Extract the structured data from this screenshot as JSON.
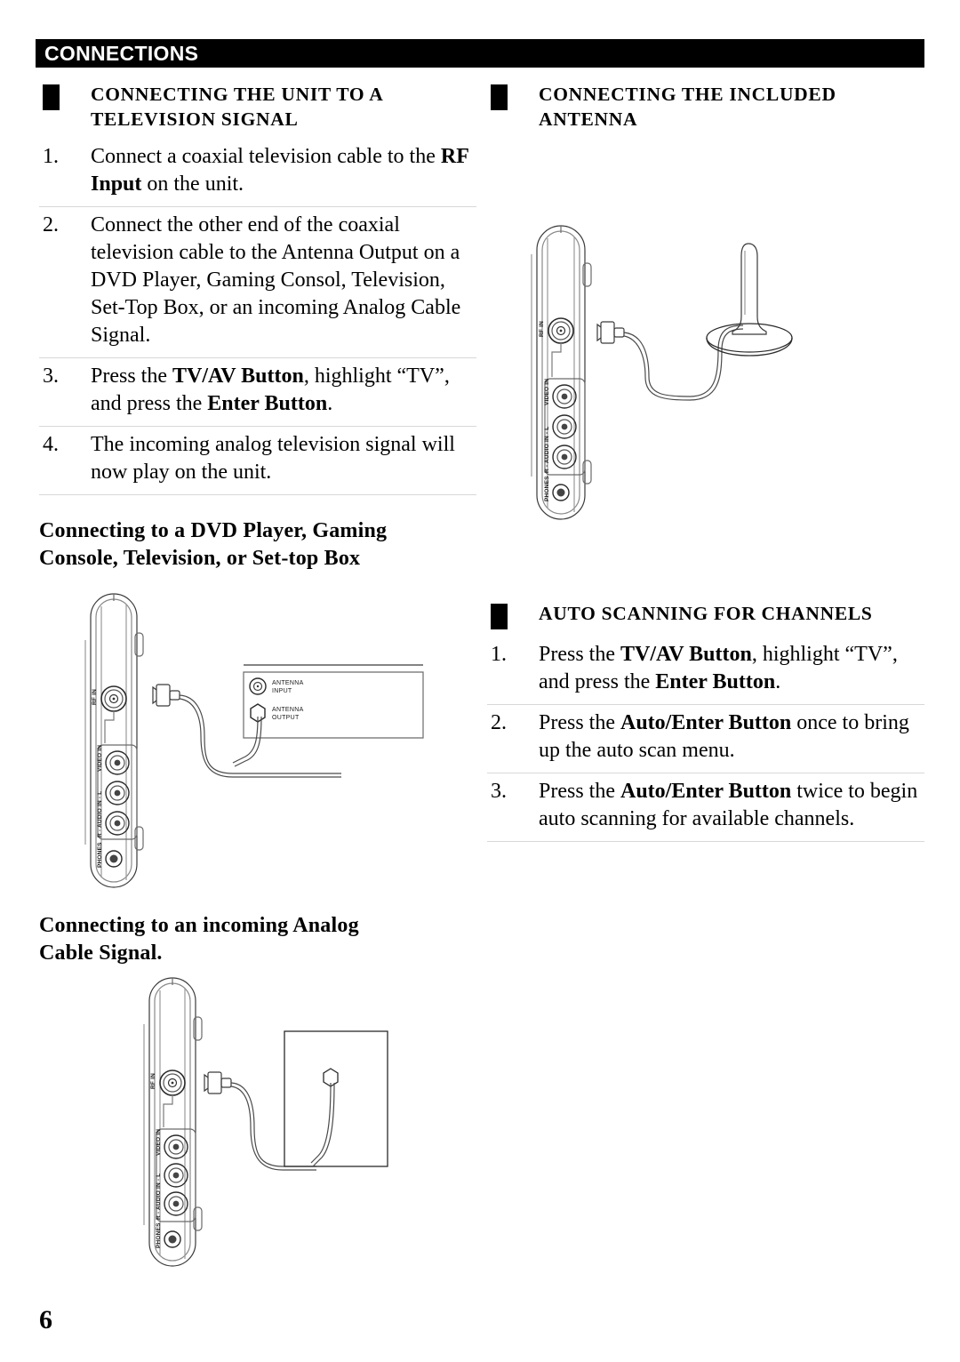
{
  "document": {
    "header_title": "CONNECTIONS",
    "page_number": "6",
    "accent_color": "#000000",
    "rule_color": "#d8d8d8"
  },
  "left_column": {
    "section": {
      "heading_line1": "CONNECTING THE UNIT TO A",
      "heading_line2": "TELEVISION SIGNAL",
      "steps": [
        {
          "number": "1.",
          "parts": [
            {
              "text": "Connect a coaxial television cable to the ",
              "bold": false
            },
            {
              "text": "RF Input",
              "bold": true
            },
            {
              "text": " on the unit.",
              "bold": false
            }
          ]
        },
        {
          "number": "2.",
          "parts": [
            {
              "text": "Connect the other end of the coaxial television cable to the Antenna Output on a DVD Player, Gaming Consol, Television, Set-Top Box, or an incoming Analog Cable Signal.",
              "bold": false
            }
          ]
        },
        {
          "number": "3.",
          "parts": [
            {
              "text": "Press the ",
              "bold": false
            },
            {
              "text": "TV/AV Button",
              "bold": true
            },
            {
              "text": ", highlight “TV”, and press the ",
              "bold": false
            },
            {
              "text": "Enter Button",
              "bold": true
            },
            {
              "text": ".",
              "bold": false
            }
          ]
        },
        {
          "number": "4.",
          "parts": [
            {
              "text": "The incoming analog television signal will now play on the unit.",
              "bold": false
            }
          ]
        }
      ]
    },
    "subheading_dvd": {
      "line1": "Connecting to a DVD Player, Gaming",
      "line2": "Console, Television, or Set-top Box"
    },
    "subheading_cable": {
      "line1": "Connecting to an incoming Analog",
      "line2": "Cable Signal."
    }
  },
  "right_column": {
    "section_antenna": {
      "heading_line1": "CONNECTING THE INCLUDED",
      "heading_line2": "ANTENNA"
    },
    "section_autoscan": {
      "heading_line1": "AUTO SCANNING FOR CHANNELS",
      "steps": [
        {
          "number": "1.",
          "parts": [
            {
              "text": "Press the ",
              "bold": false
            },
            {
              "text": "TV/AV Button",
              "bold": true
            },
            {
              "text": ", highlight “TV”, and press the ",
              "bold": false
            },
            {
              "text": "Enter Button",
              "bold": true
            },
            {
              "text": ".",
              "bold": false
            }
          ]
        },
        {
          "number": "2.",
          "parts": [
            {
              "text": "Press the ",
              "bold": false
            },
            {
              "text": "Auto/Enter Button",
              "bold": true
            },
            {
              "text": " once to bring up the auto scan menu.",
              "bold": false
            }
          ]
        },
        {
          "number": "3.",
          "parts": [
            {
              "text": "Press the ",
              "bold": false
            },
            {
              "text": "Auto/Enter Button",
              "bold": true
            },
            {
              "text": " twice to begin auto scanning for available channels.",
              "bold": false
            }
          ]
        }
      ]
    }
  },
  "figures": {
    "unit_panel_labels": {
      "rf_in": "RF IN",
      "video_in": "VIDEO IN",
      "audio_in": "R - AUDIO IN - L",
      "phones": "PHONES"
    },
    "antenna_figure": {
      "name": "connecting-included-antenna-diagram"
    },
    "dvd_figure": {
      "name": "connecting-dvd-player-diagram",
      "device_labels": {
        "antenna_input_line1": "ANTENNA",
        "antenna_input_line2": "INPUT",
        "antenna_output_line1": "ANTENNA",
        "antenna_output_line2": "OUTPUT"
      }
    },
    "cable_figure": {
      "name": "connecting-analog-cable-signal-diagram"
    }
  }
}
